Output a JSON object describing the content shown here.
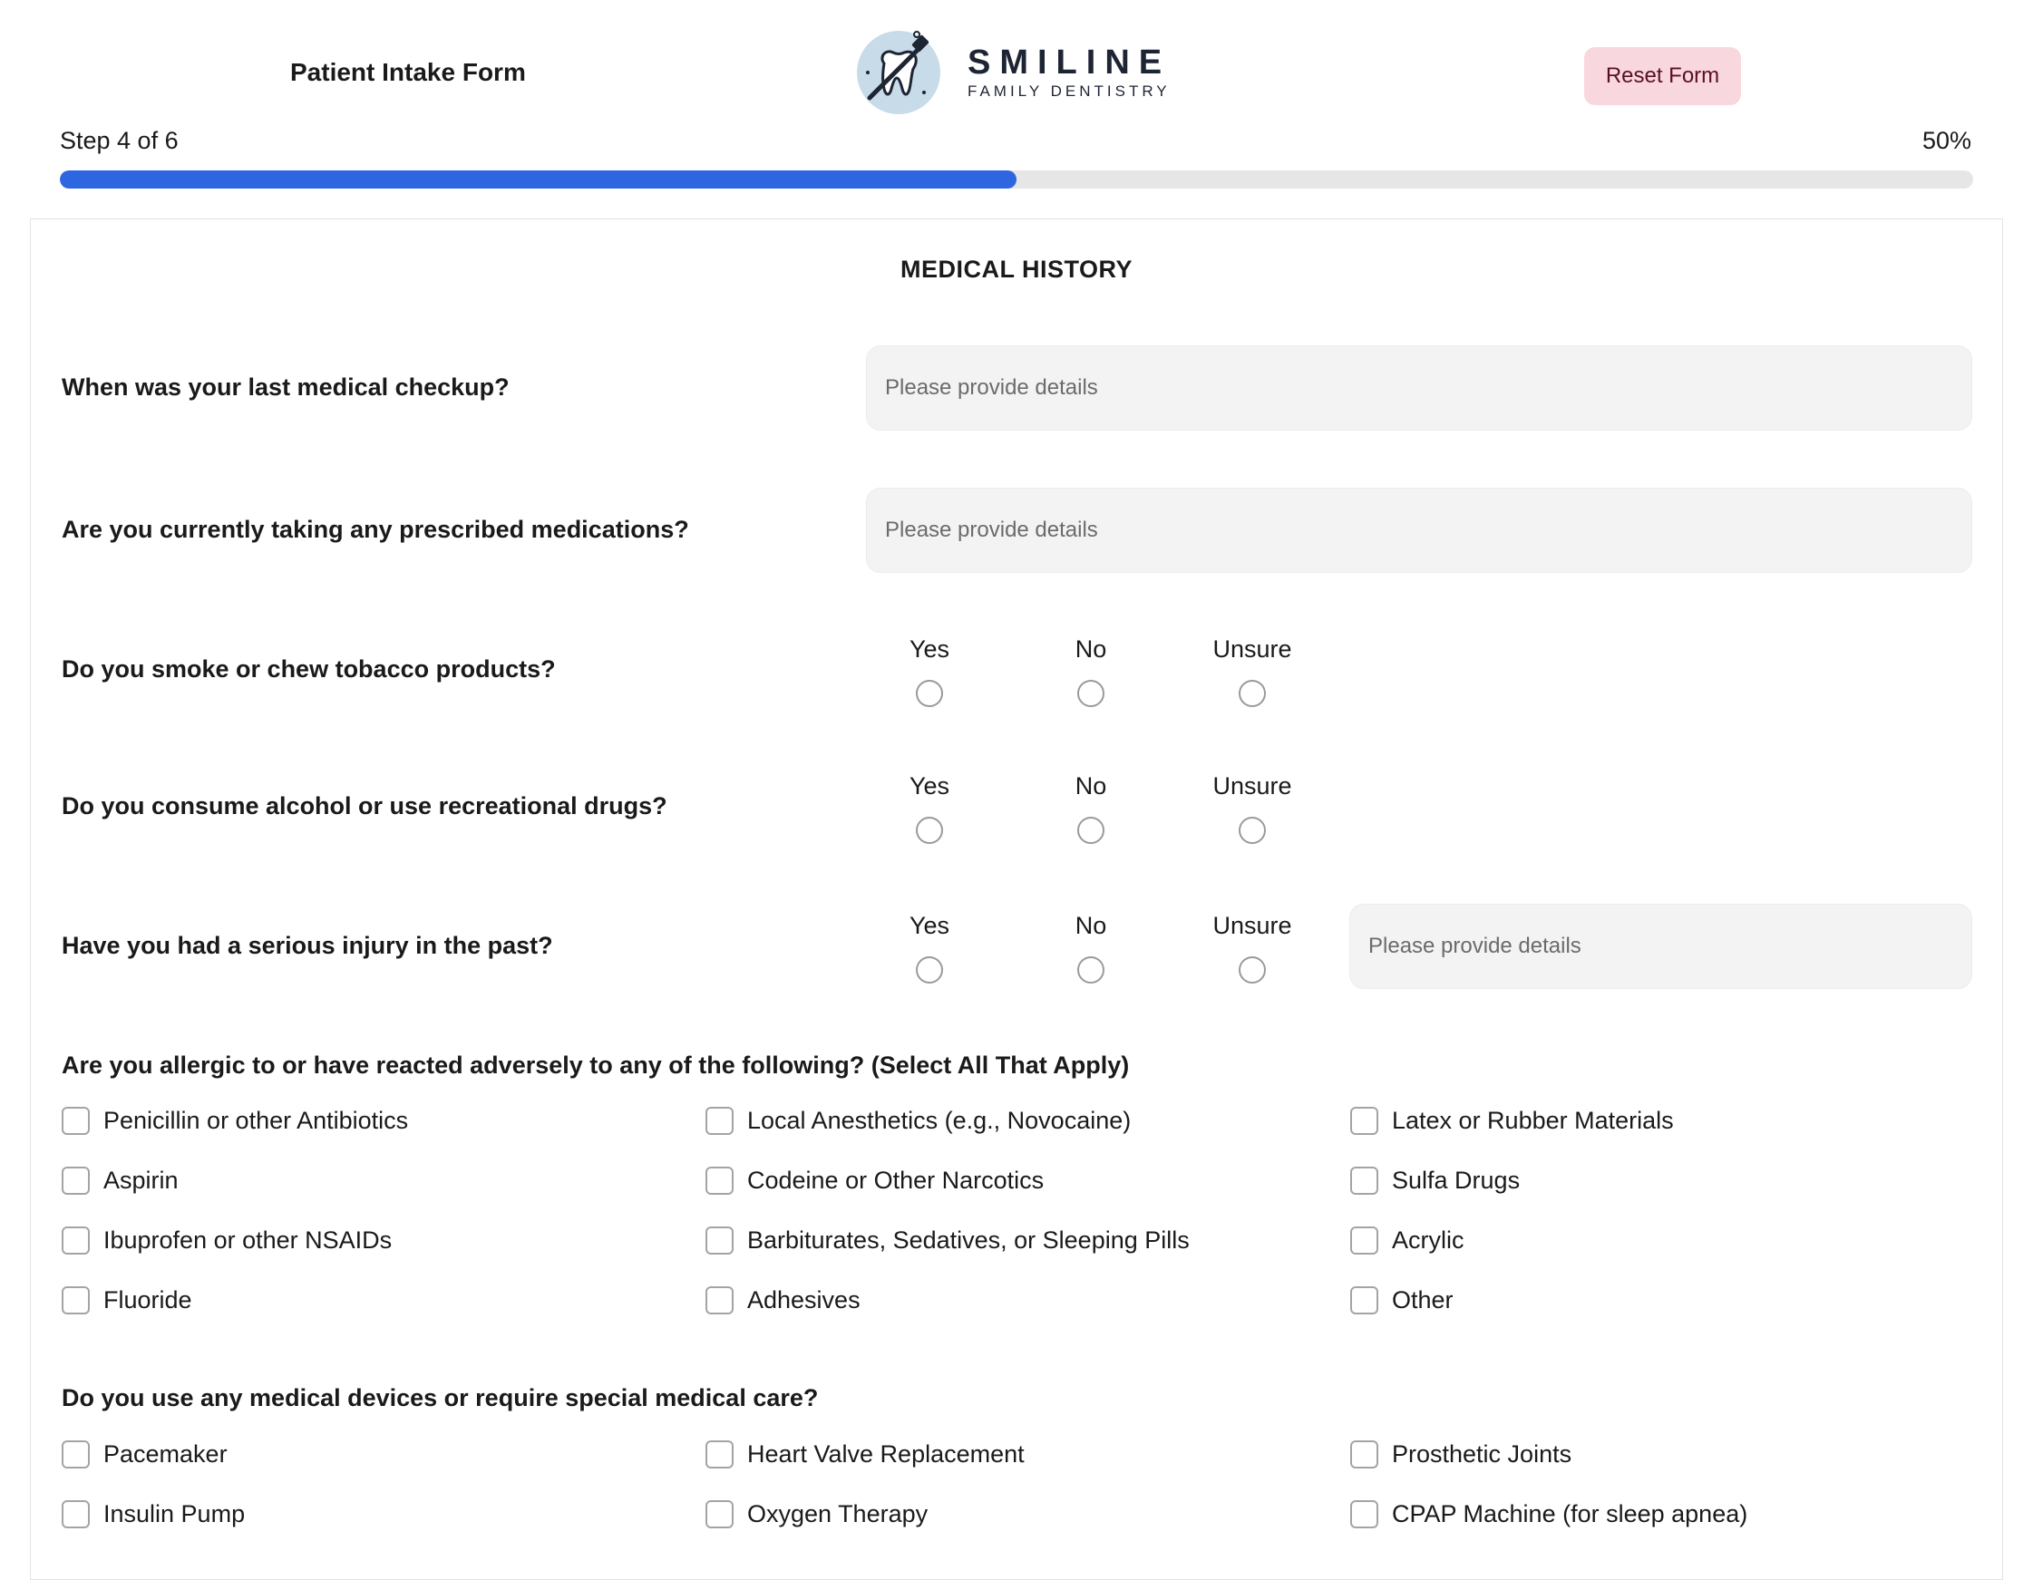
{
  "header": {
    "form_title": "Patient Intake Form",
    "logo_name": "SMILINE",
    "logo_sub": "FAMILY DENTISTRY",
    "reset_label": "Reset Form"
  },
  "progress": {
    "step_text": "Step 4 of 6",
    "percent_text": "50%",
    "value": 0.5,
    "fill_color": "#2d66e0"
  },
  "section": {
    "title": "MEDICAL HISTORY"
  },
  "questions": {
    "checkup": {
      "label": "When was your last medical checkup?",
      "placeholder": "Please provide details",
      "value": ""
    },
    "medications": {
      "label": "Are you currently taking any prescribed medications?",
      "placeholder": "Please provide details",
      "value": ""
    },
    "tobacco": {
      "label": "Do you smoke or chew tobacco products?",
      "options": [
        "Yes",
        "No",
        "Unsure"
      ],
      "selected": null
    },
    "alcohol": {
      "label": "Do you consume alcohol or use recreational drugs?",
      "options": [
        "Yes",
        "No",
        "Unsure"
      ],
      "selected": null
    },
    "injury": {
      "label": "Have you had a serious injury in the past?",
      "options": [
        "Yes",
        "No",
        "Unsure"
      ],
      "selected": null,
      "placeholder": "Please provide details",
      "value": ""
    }
  },
  "allergies": {
    "label": "Are you allergic to or have reacted adversely to any of the following? (Select All That Apply)",
    "items": [
      "Penicillin or other Antibiotics",
      "Local Anesthetics (e.g., Novocaine)",
      "Latex or Rubber Materials",
      "Aspirin",
      "Codeine or Other Narcotics",
      "Sulfa Drugs",
      "Ibuprofen or other NSAIDs",
      "Barbiturates, Sedatives, or Sleeping Pills",
      "Acrylic",
      "Fluoride",
      "Adhesives",
      "Other"
    ]
  },
  "devices": {
    "label": "Do you use any medical devices or require special medical care?",
    "items": [
      "Pacemaker",
      "Heart Valve Replacement",
      "Prosthetic Joints",
      "Insulin Pump",
      "Oxygen Therapy",
      "CPAP Machine (for sleep apnea)"
    ]
  },
  "icons": {
    "logo": "tooth-toothbrush-logo-icon"
  },
  "colors": {
    "accent": "#2d66e0",
    "reset_bg": "#f9d7de",
    "logo_circle": "#c8dbe8"
  }
}
